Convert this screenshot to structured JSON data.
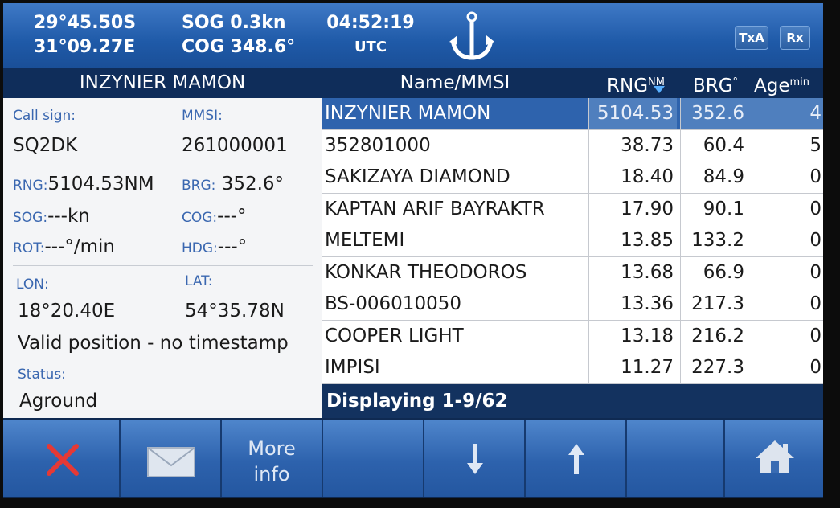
{
  "status_bar": {
    "lat": "29°45.50S",
    "lon": "31°09.27E",
    "sog": "SOG 0.3kn",
    "cog": "COG 348.6°",
    "time": "04:52:19",
    "time_zone": "UTC",
    "txa_label": "TxA",
    "rx_label": "Rx",
    "icon": "anchor-icon"
  },
  "details": {
    "title": "INZYNIER MAMON",
    "call_sign_label": "Call sign:",
    "call_sign": "SQ2DK",
    "mmsi_label": "MMSI:",
    "mmsi": "261000001",
    "rng_label": "RNG:",
    "rng": "5104.53NM",
    "brg_label": "BRG:",
    "brg": "352.6°",
    "sog_label": "SOG:",
    "sog": "---kn",
    "cog_label": "COG:",
    "cog": "---°",
    "rot_label": "ROT:",
    "rot": "---°/min",
    "hdg_label": "HDG:",
    "hdg": "---°",
    "lon_label": "LON:",
    "lon": "18°20.40E",
    "lat_label": "LAT:",
    "lat": "54°35.78N",
    "position_note": "Valid position - no timestamp",
    "status_label": "Status:",
    "status": "Aground"
  },
  "table": {
    "headers": {
      "name": "Name/MMSI",
      "rng": "RNG",
      "rng_unit": "NM",
      "brg": "BRG",
      "brg_unit": "°",
      "age": "Age",
      "age_unit": "min"
    },
    "rows": [
      {
        "name": "INZYNIER MAMON",
        "rng": "5104.53",
        "brg": "352.6",
        "age": "4",
        "selected": true
      },
      {
        "name": "352801000",
        "rng": "38.73",
        "brg": "60.4",
        "age": "5"
      },
      {
        "name": "SAKIZAYA DIAMOND",
        "rng": "18.40",
        "brg": "84.9",
        "age": "0"
      },
      {
        "name": "KAPTAN ARIF BAYRAKTR",
        "rng": "17.90",
        "brg": "90.1",
        "age": "0"
      },
      {
        "name": "MELTEMI",
        "rng": "13.85",
        "brg": "133.2",
        "age": "0"
      },
      {
        "name": "KONKAR THEODOROS",
        "rng": "13.68",
        "brg": "66.9",
        "age": "0"
      },
      {
        "name": "BS-006010050",
        "rng": "13.36",
        "brg": "217.3",
        "age": "0"
      },
      {
        "name": "COOPER LIGHT",
        "rng": "13.18",
        "brg": "216.2",
        "age": "0"
      },
      {
        "name": "IMPISI",
        "rng": "11.27",
        "brg": "227.3",
        "age": "0"
      }
    ],
    "footer": "Displaying 1-9/62"
  },
  "buttons": {
    "close_icon": "close-icon",
    "mail_icon": "mail-icon",
    "more_line1": "More",
    "more_line2": "info",
    "down_icon": "arrow-down-icon",
    "up_icon": "arrow-up-icon",
    "home_icon": "home-icon",
    "colors": {
      "close": "#e53935",
      "button": "#2d62ad"
    }
  }
}
